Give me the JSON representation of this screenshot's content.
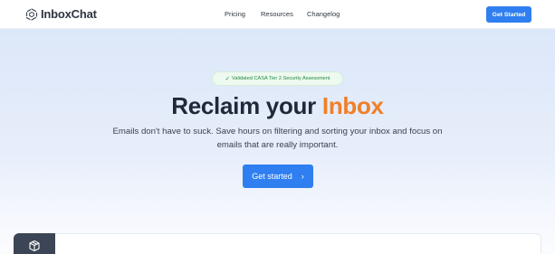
{
  "header": {
    "logo_text": "InboxChat",
    "nav": [
      {
        "label": "Pricing"
      },
      {
        "label": "Resources"
      },
      {
        "label": "Changelog"
      }
    ],
    "cta_label": "Get Started"
  },
  "hero": {
    "badge_text": "Validated CASA Tier 2 Security Assessment",
    "headline_main": "Reclaim your",
    "headline_accent": "Inbox",
    "subtitle": "Emails don't have to suck. Save hours on filtering and sorting your inbox and focus on emails that are really important.",
    "cta_label": "Get started",
    "cta_icon": "chevron-right-icon"
  },
  "colors": {
    "brand_blue": "#2f7ff0",
    "accent_orange": "#f07f28",
    "badge_green": "#1f8a3e",
    "dark_text": "#1f2937"
  },
  "icons": {
    "logo": "hexagon-logo-icon",
    "badge": "check-icon",
    "card": "cube-icon"
  }
}
